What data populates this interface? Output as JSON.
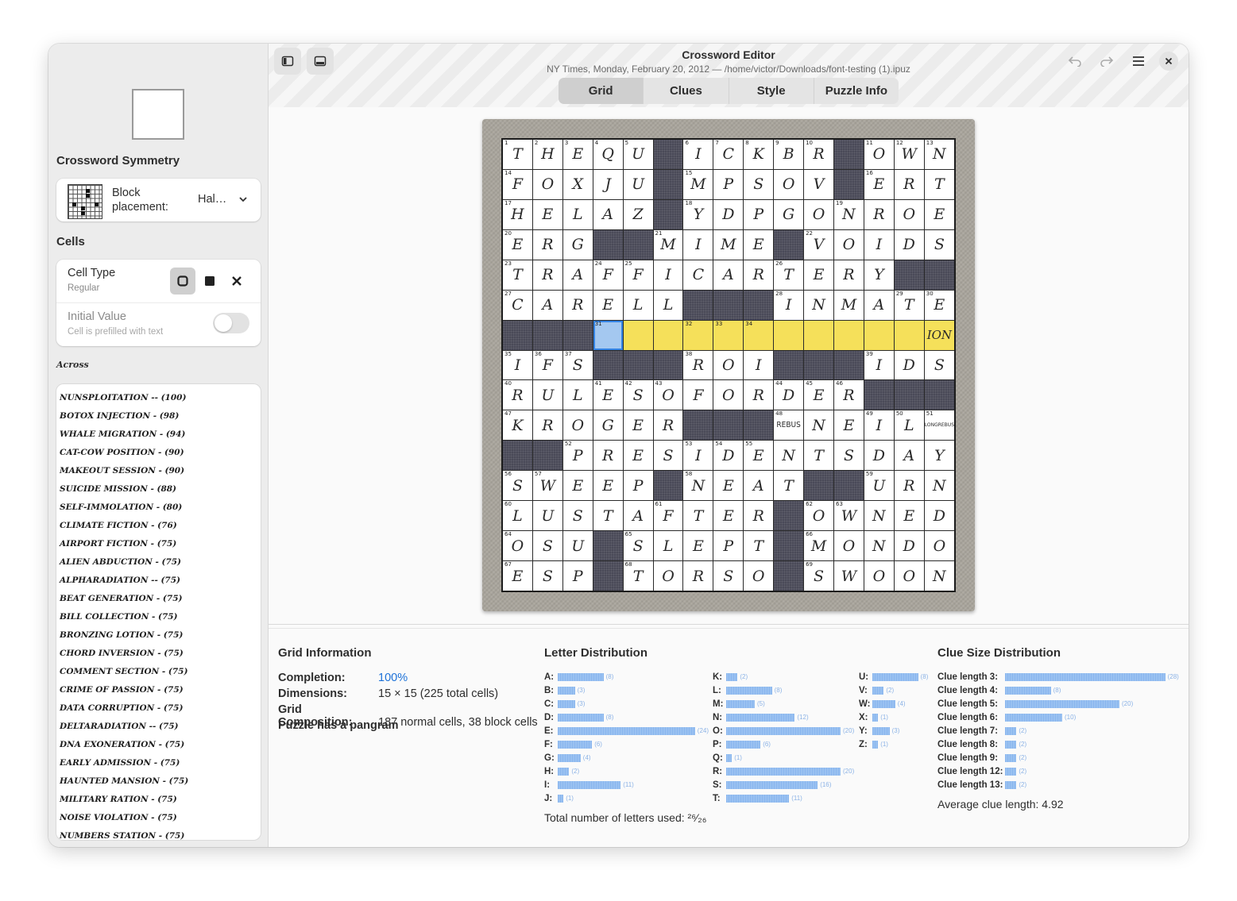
{
  "window": {
    "title": "Crossword Editor",
    "subtitle": "NY Times, Monday, February 20, 2012 — /home/victor/Downloads/font-testing (1).ipuz"
  },
  "tabs": [
    {
      "label": "Grid",
      "active": true
    },
    {
      "label": "Clues",
      "active": false
    },
    {
      "label": "Style",
      "active": false
    },
    {
      "label": "Puzzle Info",
      "active": false
    }
  ],
  "sidebar": {
    "symmetry_heading": "Crossword Symmetry",
    "block_placement_label": "Block placement:",
    "block_placement_value": "Hal…",
    "cells_heading": "Cells",
    "cell_type_label": "Cell Type",
    "cell_type_value": "Regular",
    "cell_type_options": [
      "normal-cell-icon",
      "block-cell-icon",
      "null-cell-icon"
    ],
    "initial_value_label": "Initial Value",
    "initial_value_hint": "Cell is prefilled with text",
    "initial_value_on": false,
    "across_heading": "Across",
    "clues": [
      "NUNSPLOITATION -- (100)",
      "BOTOX INJECTION - (98)",
      "WHALE MIGRATION - (94)",
      "CAT-COW POSITION - (90)",
      "MAKEOUT SESSION - (90)",
      "SUICIDE MISSION - (88)",
      "SELF-IMMOLATION - (80)",
      "CLIMATE FICTION - (76)",
      "AIRPORT FICTION - (75)",
      "ALIEN ABDUCTION - (75)",
      "ALPHARADIATION -- (75)",
      "BEAT GENERATION - (75)",
      "BILL COLLECTION - (75)",
      "BRONZING LOTION - (75)",
      "CHORD INVERSION - (75)",
      "COMMENT SECTION - (75)",
      "CRIME OF PASSION - (75)",
      "DATA CORRUPTION - (75)",
      "DELTARADIATION -- (75)",
      "DNA EXONERATION - (75)",
      "EARLY ADMISSION - (75)",
      "HAUNTED MANSION - (75)",
      "MILITARY RATION - (75)",
      "NOISE VIOLATION - (75)",
      "NUMBERS STATION - (75)"
    ]
  },
  "grid": {
    "rows": [
      [
        "1:T",
        "2:H",
        "3:E",
        "4:Q",
        "5:U",
        "#",
        "6:I",
        "7:C",
        "8:K",
        "9:B",
        "10:R",
        "#",
        "11:O",
        "12:W",
        "13:N"
      ],
      [
        "14:F",
        "O",
        "X",
        "J",
        "U",
        "#",
        "15:M",
        "P",
        "S",
        "O",
        "V",
        "#",
        "16:E",
        "R",
        "T"
      ],
      [
        "17:H",
        "E",
        "L",
        "A",
        "Z",
        "#",
        "18:Y",
        "D",
        "P",
        "G",
        "O",
        "19:N",
        "R",
        "O",
        "E"
      ],
      [
        "20:E",
        "R",
        "G",
        "#",
        "#",
        "21:M",
        "I",
        "M",
        "E",
        "#",
        "22:V",
        "O",
        "I",
        "D",
        "S"
      ],
      [
        "23:T",
        "R",
        "A",
        "24:F",
        "25:F",
        "I",
        "C",
        "A",
        "R",
        "26:T",
        "E",
        "R",
        "Y",
        "#",
        "#"
      ],
      [
        "27:C",
        "A",
        "R",
        "E",
        "L",
        "L",
        "#",
        "#",
        "#",
        "28:I",
        "N",
        "M",
        "A",
        "29:T",
        "30:E"
      ],
      [
        "#",
        "#",
        "#",
        "31:",
        "",
        "",
        "32:",
        "33:",
        "34:",
        "",
        "",
        "",
        "",
        "",
        "ION"
      ],
      [
        "35:I",
        "36:F",
        "37:S",
        "#",
        "#",
        "#",
        "38:R",
        "O",
        "I",
        "#",
        "#",
        "#",
        "39:I",
        "D",
        "S"
      ],
      [
        "40:R",
        "U",
        "L",
        "41:E",
        "42:S",
        "43:O",
        "F",
        "O",
        "R",
        "44:D",
        "45:E",
        "46:R",
        "#",
        "#",
        "#"
      ],
      [
        "47:K",
        "R",
        "O",
        "G",
        "E",
        "R",
        "#",
        "#",
        "#",
        "48:REBUS",
        "N",
        "E",
        "49:I",
        "50:L",
        "51:LONGREBUS"
      ],
      [
        "#",
        "#",
        "52:P",
        "R",
        "E",
        "S",
        "53:I",
        "54:D",
        "55:E",
        "N",
        "T",
        "S",
        "D",
        "A",
        "Y"
      ],
      [
        "56:S",
        "57:W",
        "E",
        "E",
        "P",
        "#",
        "58:N",
        "E",
        "A",
        "T",
        "#",
        "#",
        "59:U",
        "R",
        "N"
      ],
      [
        "60:L",
        "U",
        "S",
        "T",
        "A",
        "61:F",
        "T",
        "E",
        "R",
        "#",
        "62:O",
        "63:W",
        "N",
        "E",
        "D"
      ],
      [
        "64:O",
        "S",
        "U",
        "#",
        "65:S",
        "L",
        "E",
        "P",
        "T",
        "#",
        "66:M",
        "O",
        "N",
        "D",
        "O"
      ],
      [
        "67:E",
        "S",
        "P",
        "#",
        "68:T",
        "O",
        "R",
        "S",
        "O",
        "#",
        "69:S",
        "W",
        "O",
        "O",
        "N"
      ]
    ],
    "highlight_row": 6,
    "selected_cell": [
      6,
      3
    ]
  },
  "info": {
    "heading": "Grid Information",
    "completion_label": "Completion:",
    "completion_value": "100%",
    "dimensions_label": "Dimensions:",
    "dimensions_value": "15 × 15 (225 total cells)",
    "composition_label": "Grid Composition:",
    "composition_value": "187 normal cells, 38 block cells",
    "pangram": "Puzzle has a pangram"
  },
  "letters": {
    "heading": "Letter Distribution",
    "columns": [
      [
        [
          "A:",
          8
        ],
        [
          "B:",
          3
        ],
        [
          "C:",
          3
        ],
        [
          "D:",
          8
        ],
        [
          "E:",
          24
        ],
        [
          "F:",
          6
        ],
        [
          "G:",
          4
        ],
        [
          "H:",
          2
        ],
        [
          "I:",
          11
        ],
        [
          "J:",
          1
        ]
      ],
      [
        [
          "K:",
          2
        ],
        [
          "L:",
          8
        ],
        [
          "M:",
          5
        ],
        [
          "N:",
          12
        ],
        [
          "O:",
          20
        ],
        [
          "P:",
          6
        ],
        [
          "Q:",
          1
        ],
        [
          "R:",
          20
        ],
        [
          "S:",
          16
        ],
        [
          "T:",
          11
        ]
      ],
      [
        [
          "U:",
          8
        ],
        [
          "V:",
          2
        ],
        [
          "W:",
          4
        ],
        [
          "X:",
          1
        ],
        [
          "Y:",
          3
        ],
        [
          "Z:",
          1
        ]
      ]
    ],
    "total": "Total number of letters used: ²⁶⁄₂₆"
  },
  "clue_sizes": {
    "heading": "Clue Size Distribution",
    "rows": [
      [
        "Clue length 3:",
        28
      ],
      [
        "Clue length 4:",
        8
      ],
      [
        "Clue length 5:",
        20
      ],
      [
        "Clue length 6:",
        10
      ],
      [
        "Clue length 7:",
        2
      ],
      [
        "Clue length 8:",
        2
      ],
      [
        "Clue length 9:",
        2
      ],
      [
        "Clue length 12:",
        2
      ],
      [
        "Clue length 13:",
        2
      ]
    ],
    "average": "Average clue length: 4.92"
  }
}
